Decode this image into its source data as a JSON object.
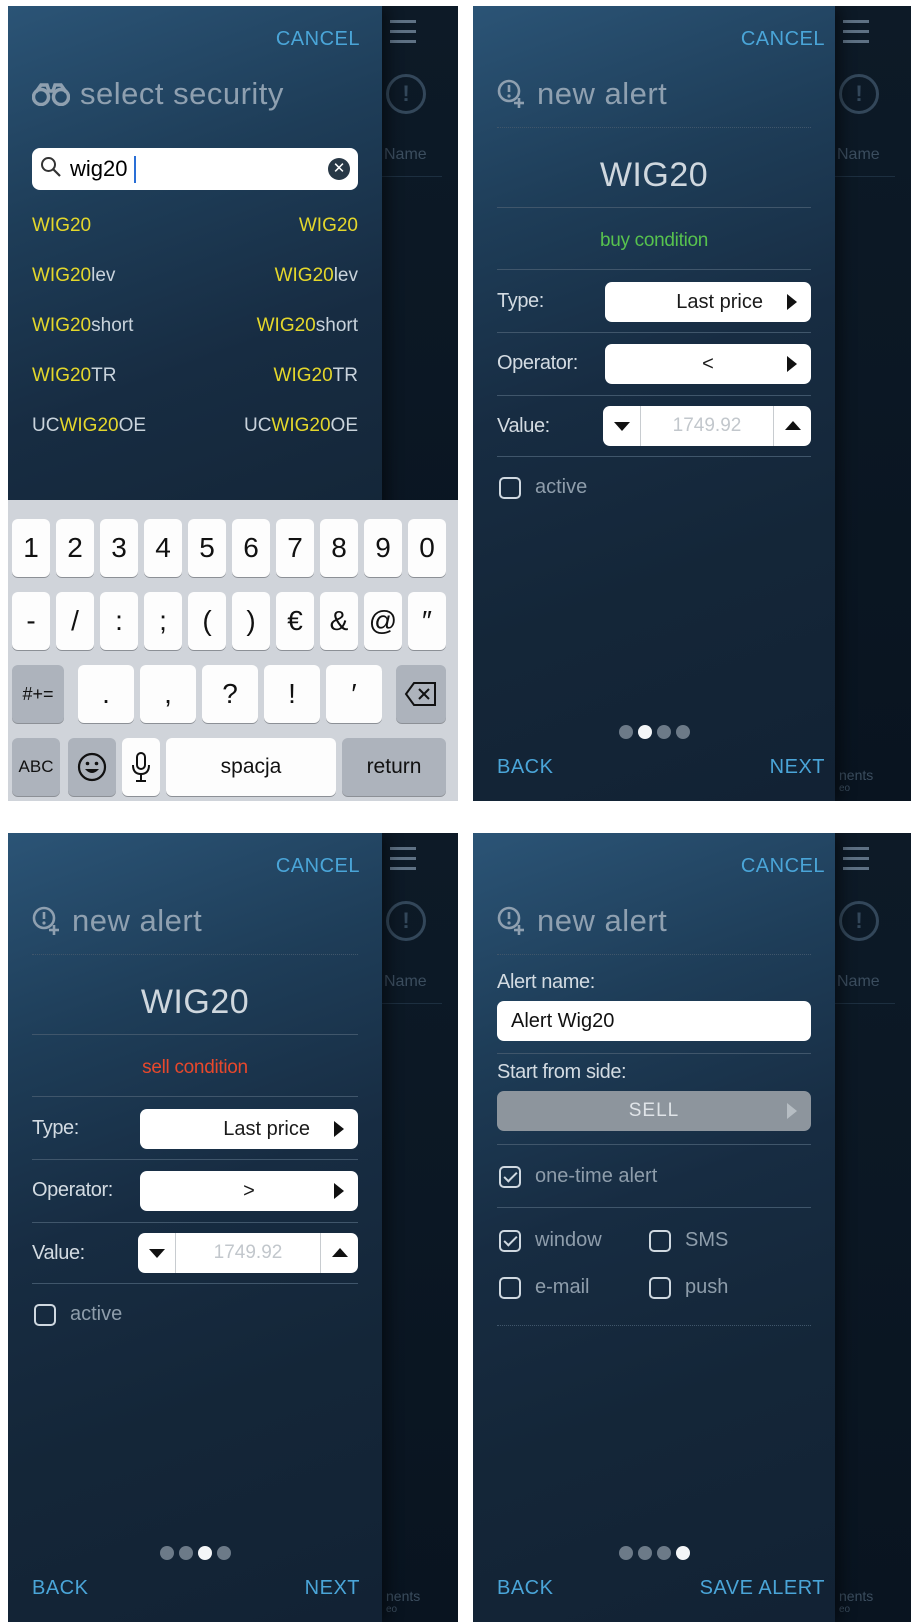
{
  "common": {
    "cancel": "CANCEL",
    "back": "BACK",
    "next": "NEXT",
    "bg_name": "Name",
    "bg_bottom_1": "nents",
    "bg_bottom_2": "eo",
    "bg_alert_glyph": "!"
  },
  "screen1": {
    "title": "select security",
    "search_value": "wig20",
    "results": [
      {
        "left_pre": "",
        "left_hl": "WIG20",
        "left_post": "",
        "right_pre": "",
        "right_hl": "WIG20",
        "right_post": ""
      },
      {
        "left_pre": "",
        "left_hl": "WIG20",
        "left_post": "lev",
        "right_pre": "",
        "right_hl": "WIG20",
        "right_post": "lev"
      },
      {
        "left_pre": "",
        "left_hl": "WIG20",
        "left_post": "short",
        "right_pre": "",
        "right_hl": "WIG20",
        "right_post": "short"
      },
      {
        "left_pre": "",
        "left_hl": "WIG20",
        "left_post": "TR",
        "right_pre": "",
        "right_hl": "WIG20",
        "right_post": "TR"
      },
      {
        "left_pre": "UC",
        "left_hl": "WIG20",
        "left_post": "OE",
        "right_pre": "UC",
        "right_hl": "WIG20",
        "right_post": "OE"
      }
    ],
    "keyboard": {
      "row1": [
        "1",
        "2",
        "3",
        "4",
        "5",
        "6",
        "7",
        "8",
        "9",
        "0"
      ],
      "row2": [
        "-",
        "/",
        ":",
        ";",
        "(",
        ")",
        "€",
        "&",
        "@",
        "″"
      ],
      "row3": [
        ".",
        ",",
        "?",
        "!",
        "′"
      ],
      "shift_label": "#+=",
      "abc_label": "ABC",
      "space_label": "spacja",
      "return_label": "return"
    }
  },
  "screen2": {
    "title": "new alert",
    "symbol": "WIG20",
    "condition": "buy condition",
    "type_label": "Type:",
    "type_value": "Last price",
    "operator_label": "Operator:",
    "operator_value": "<",
    "value_label": "Value:",
    "value": "1749.92",
    "active_label": "active",
    "active_checked": false,
    "page_index": 1,
    "condition_color": "#57c24e"
  },
  "screen3": {
    "title": "new alert",
    "symbol": "WIG20",
    "condition": "sell condition",
    "type_label": "Type:",
    "type_value": "Last price",
    "operator_label": "Operator:",
    "operator_value": ">",
    "value_label": "Value:",
    "value": "1749.92",
    "active_label": "active",
    "active_checked": false,
    "page_index": 2,
    "condition_color": "#e8482c"
  },
  "screen4": {
    "title": "new alert",
    "alert_name_label": "Alert name:",
    "alert_name_value": "Alert Wig20",
    "start_side_label": "Start from side:",
    "start_side_value": "SELL",
    "one_time_label": "one-time alert",
    "one_time_checked": true,
    "window_label": "window",
    "window_checked": true,
    "sms_label": "SMS",
    "sms_checked": false,
    "email_label": "e-mail",
    "email_checked": false,
    "push_label": "push",
    "push_checked": false,
    "save_label": "SAVE ALERT",
    "page_index": 3
  },
  "colors": {
    "accent": "#4aa5d8",
    "highlight": "#e4d72b"
  }
}
